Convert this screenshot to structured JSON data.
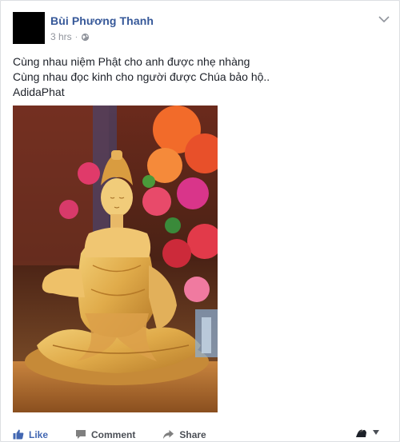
{
  "post": {
    "author": "Bùi Phương Thanh",
    "time": "3 hrs",
    "separator": "·",
    "privacy_icon": "globe-icon",
    "lines": [
      "Cùng nhau niệm Phật cho anh được nhẹ nhàng",
      "Cùng nhau đọc kinh cho người được Chúa bảo hộ..",
      "AdidaPhat"
    ],
    "photo_icon": "buddha-statue-photo"
  },
  "actions": {
    "like": "Like",
    "comment": "Comment",
    "share": "Share"
  },
  "colors": {
    "author": "#365899",
    "like": "#4267b2",
    "meta": "#90949c"
  }
}
